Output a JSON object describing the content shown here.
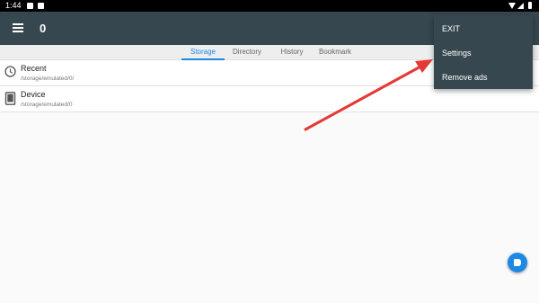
{
  "status_bar": {
    "time": "1:44"
  },
  "app_bar": {
    "title": "0"
  },
  "tabs": [
    {
      "label": "Storage",
      "active": true
    },
    {
      "label": "Directory",
      "active": false
    },
    {
      "label": "History",
      "active": false
    },
    {
      "label": "Bookmark",
      "active": false
    }
  ],
  "list": [
    {
      "title": "Recent",
      "path": "/storage/emulated/0/",
      "icon": "clock-icon"
    },
    {
      "title": "Device",
      "path": "/storage/emulated/0",
      "icon": "tablet-icon"
    }
  ],
  "menu": {
    "items": [
      {
        "label": "EXIT"
      },
      {
        "label": "Settings"
      },
      {
        "label": "Remove ads"
      }
    ]
  },
  "colors": {
    "app_bar": "#37474f",
    "accent": "#1e88e5",
    "arrow": "#e53935"
  }
}
